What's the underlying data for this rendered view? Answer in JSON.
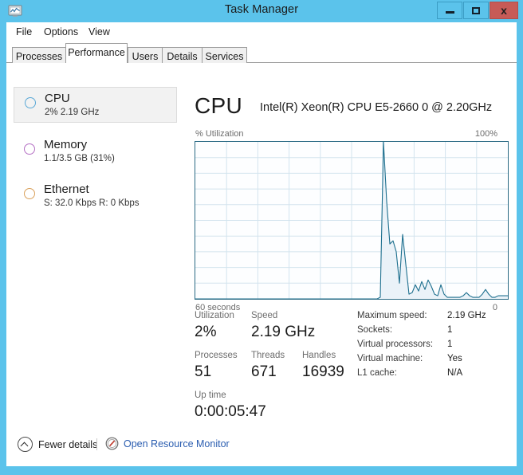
{
  "window": {
    "title": "Task Manager",
    "icon": "task-manager-icon",
    "frame_color": "#5bc3eb",
    "controls": {
      "minimize": "minimize-icon",
      "maximize": "maximize-icon",
      "close_label": "x",
      "close_color": "#c75b57"
    }
  },
  "menu": {
    "items": [
      {
        "label": "File"
      },
      {
        "label": "Options"
      },
      {
        "label": "View"
      }
    ]
  },
  "tabs": {
    "active": "Performance",
    "items": [
      {
        "label": "Processes"
      },
      {
        "label": "Performance"
      },
      {
        "label": "Users"
      },
      {
        "label": "Details"
      },
      {
        "label": "Services"
      }
    ]
  },
  "sidebar": {
    "items": [
      {
        "name": "CPU",
        "detail": "2%  2.19 GHz",
        "color": "#5aa8d6",
        "selected": true
      },
      {
        "name": "Memory",
        "detail": "1.1/3.5 GB (31%)",
        "color": "#b46fc4",
        "selected": false
      },
      {
        "name": "Ethernet",
        "detail": "S: 32.0 Kbps R: 0 Kbps",
        "color": "#d9a05b",
        "selected": false
      }
    ]
  },
  "detail": {
    "heading": "CPU",
    "model": "Intel(R) Xeon(R) CPU E5-2660 0 @ 2.20GHz",
    "graph": {
      "axis_label": "% Utilization",
      "axis_max": "100%",
      "foot_left": "60 seconds",
      "foot_right": "0",
      "line_color": "#1d6f8e",
      "fill_color": "#eaf2f8"
    },
    "stats": [
      {
        "label": "Utilization",
        "value": "2%"
      },
      {
        "label": "Speed",
        "value": "2.19 GHz"
      },
      {
        "label": "Processes",
        "value": "51"
      },
      {
        "label": "Threads",
        "value": "671"
      },
      {
        "label": "Handles",
        "value": "16939"
      },
      {
        "label": "Up time",
        "value": "0:00:05:47"
      }
    ],
    "system_info": [
      {
        "label": "Maximum speed:",
        "value": "2.19 GHz"
      },
      {
        "label": "Sockets:",
        "value": "1"
      },
      {
        "label": "Virtual processors:",
        "value": "1"
      },
      {
        "label": "Virtual machine:",
        "value": "Yes"
      },
      {
        "label": "L1 cache:",
        "value": "N/A"
      }
    ]
  },
  "footer": {
    "fewer_details": "Fewer details",
    "open_resource_monitor": "Open Resource Monitor",
    "link_color": "#2a5db0"
  },
  "chart_data": {
    "type": "area",
    "title": "% Utilization",
    "xlabel": "60 seconds",
    "ylabel": "% Utilization",
    "ylim": [
      0,
      100
    ],
    "xlim": [
      60,
      0
    ],
    "grid": true,
    "grid_rows": 10,
    "grid_cols": 10,
    "series": [
      {
        "name": "CPU utilization",
        "values": [
          0,
          0,
          0,
          0,
          0,
          0,
          0,
          0,
          0,
          0,
          0,
          0,
          0,
          0,
          0,
          0,
          0,
          0,
          0,
          0,
          0,
          0,
          0,
          0,
          0,
          0,
          0,
          0,
          0,
          0,
          0,
          0,
          0,
          0,
          0,
          0,
          0,
          0,
          0,
          0,
          0,
          0,
          0,
          0,
          0,
          0,
          0,
          0,
          0,
          0,
          0,
          0,
          0,
          0,
          0,
          0,
          0,
          0,
          1,
          100,
          62,
          35,
          37,
          30,
          10,
          41,
          22,
          3,
          4,
          9,
          5,
          11,
          6,
          12,
          8,
          3,
          2,
          9,
          3,
          1,
          1,
          1,
          1,
          1,
          2,
          4,
          2,
          1,
          1,
          1,
          3,
          6,
          3,
          1,
          1,
          2,
          2,
          2,
          2
        ]
      }
    ]
  }
}
